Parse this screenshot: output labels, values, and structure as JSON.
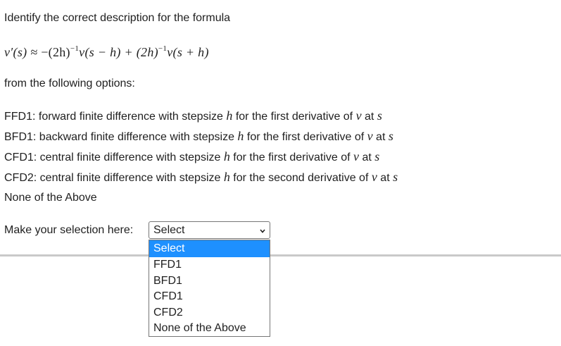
{
  "question": {
    "intro": "Identify the correct description for the formula",
    "formula": {
      "lhs": "v′(s) ≈ ",
      "term1_prefix": "−(2h)",
      "exponent": "−1",
      "term1_suffix": "v(s − h) + (2h)",
      "term2_suffix": "v(s + h)"
    },
    "from_text": "from the following options:",
    "options": [
      {
        "prefix": "FFD1: forward finite difference with stepsize ",
        "mid": " for the first derivative of ",
        "tail": " at "
      },
      {
        "prefix": "BFD1: backward finite difference with stepsize ",
        "mid": " for the first derivative of ",
        "tail": " at "
      },
      {
        "prefix": "CFD1: central finite difference with stepsize ",
        "mid": " for the first derivative of ",
        "tail": " at "
      },
      {
        "prefix": "CFD2: central finite difference with stepsize ",
        "mid": " for the second derivative of ",
        "tail": " at "
      }
    ],
    "none_option": "None of the Above",
    "vars": {
      "h": "h",
      "v": "v",
      "s": "s"
    }
  },
  "selection": {
    "label": "Make your selection here:",
    "current_value": "Select",
    "dropdown_options": [
      "Select",
      "FFD1",
      "BFD1",
      "CFD1",
      "CFD2",
      "None of the Above"
    ],
    "highlight_color": "#1e90ff"
  }
}
